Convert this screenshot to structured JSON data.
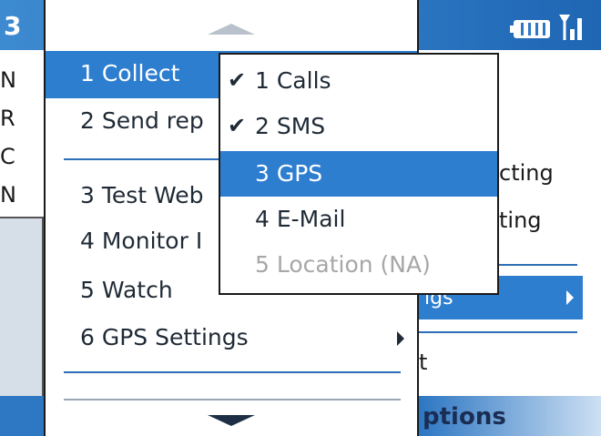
{
  "status": {
    "time": "3"
  },
  "background": {
    "left_letters": [
      "N",
      "R",
      "C",
      "N"
    ],
    "right_items": [
      "cting",
      "ting",
      "t"
    ],
    "settings_label": "igs",
    "softkey_right": "ptions"
  },
  "menu": {
    "items": [
      {
        "label": "1 Collect",
        "selected": true
      },
      {
        "label": "2 Send rep"
      },
      {
        "label": "3 Test Web"
      },
      {
        "label": "4 Monitor I"
      },
      {
        "label": "5 Watch"
      },
      {
        "label": "6 GPS Settings",
        "has_submenu": true
      }
    ]
  },
  "submenu": {
    "items": [
      {
        "label": "1 Calls",
        "checked": true,
        "check": "✔"
      },
      {
        "label": "2 SMS",
        "checked": true,
        "check": "✔"
      },
      {
        "label": "3 GPS",
        "selected": true,
        "check": ""
      },
      {
        "label": "4 E-Mail",
        "check": ""
      },
      {
        "label": "5 Location (NA)",
        "disabled": true,
        "check": ""
      }
    ]
  },
  "colors": {
    "accent": "#2e7ed0",
    "title_bar": "#2d78c4",
    "disabled_text": "#a7a7a7"
  }
}
